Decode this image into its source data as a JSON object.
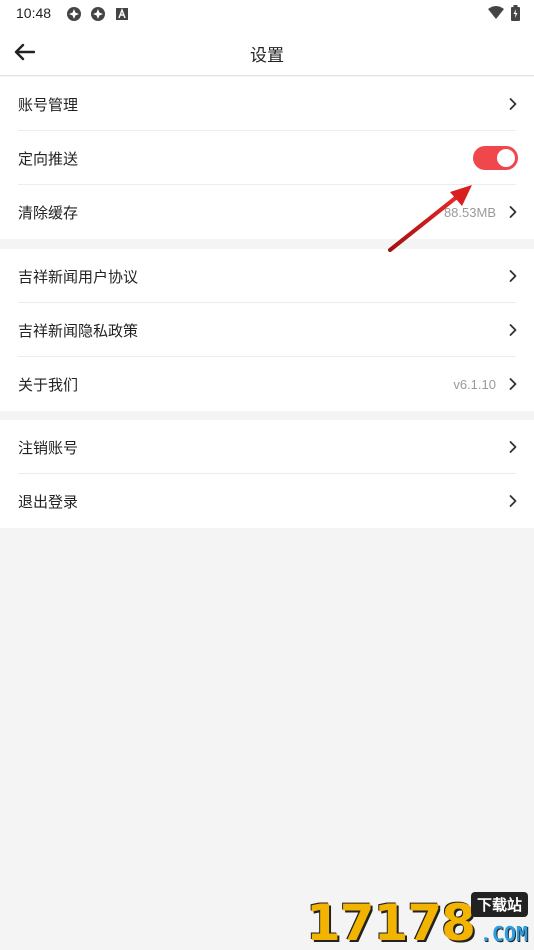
{
  "status_bar": {
    "time": "10:48"
  },
  "header": {
    "title": "设置"
  },
  "groups": [
    {
      "items": [
        {
          "label": "账号管理",
          "value": ""
        },
        {
          "label": "定向推送",
          "toggle_on": true
        },
        {
          "label": "清除缓存",
          "value": "88.53MB"
        }
      ]
    },
    {
      "items": [
        {
          "label": "吉祥新闻用户协议",
          "value": ""
        },
        {
          "label": "吉祥新闻隐私政策",
          "value": ""
        },
        {
          "label": "关于我们",
          "value": "v6.1.10"
        }
      ]
    },
    {
      "items": [
        {
          "label": "注销账号",
          "value": ""
        },
        {
          "label": "退出登录",
          "value": ""
        }
      ]
    }
  ],
  "watermark": {
    "digits": "17178",
    "badge": "下载站",
    "domain": ".COM"
  },
  "colors": {
    "toggle_on": "#f0474c",
    "annotation_arrow": "#d81e1e",
    "background": "#f4f4f4"
  },
  "icons": {
    "back": "arrow-left-icon",
    "chevron": "chevron-right-icon"
  }
}
